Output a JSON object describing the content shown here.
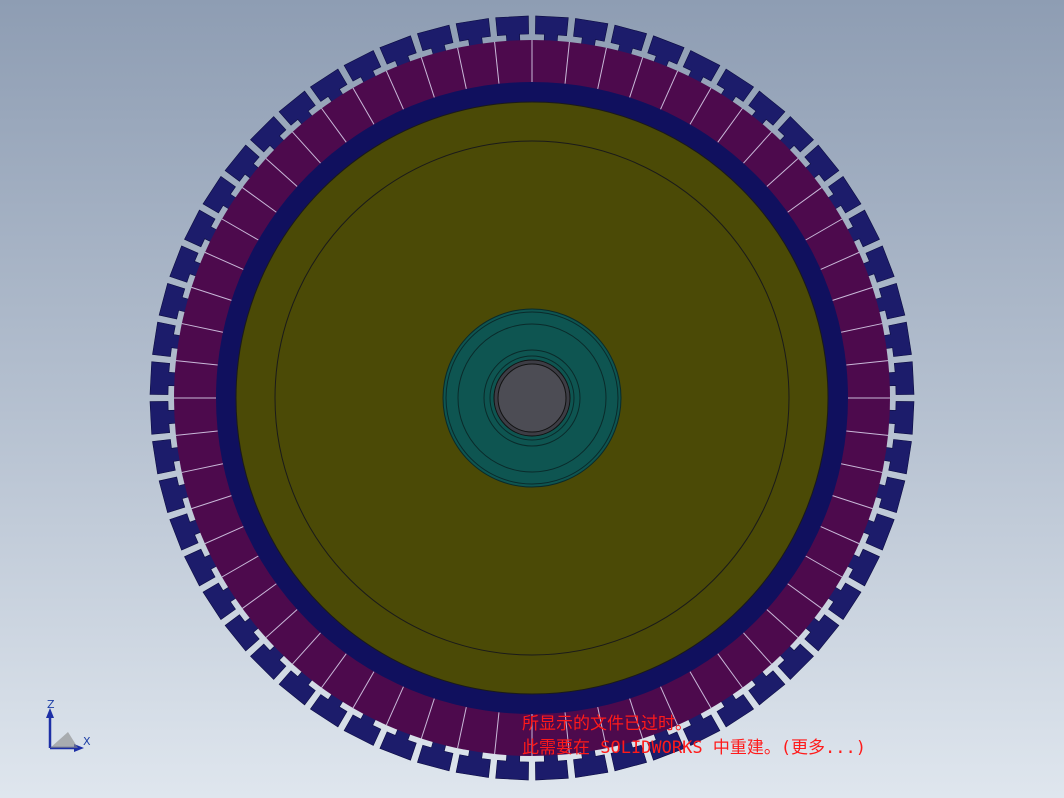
{
  "viewport": {
    "background_top": "#8e9db3",
    "background_bottom": "#dfe6ee"
  },
  "model": {
    "stator_tooth_count": 60,
    "rotor_magnet_count": 60,
    "colors": {
      "stator": "#1c1c6b",
      "magnet": "#4d0a4d",
      "rotor_ring": "#10105e",
      "rotor_core": "#4b4a06",
      "hub": "#0e5551",
      "shaft": "#4c4c54"
    }
  },
  "triad": {
    "z_label": "Z",
    "x_label": "X"
  },
  "message": {
    "line1": "所显示的文件已过时。",
    "line2": "此需要在 SOLIDWORKS 中重建。(更多...)"
  }
}
